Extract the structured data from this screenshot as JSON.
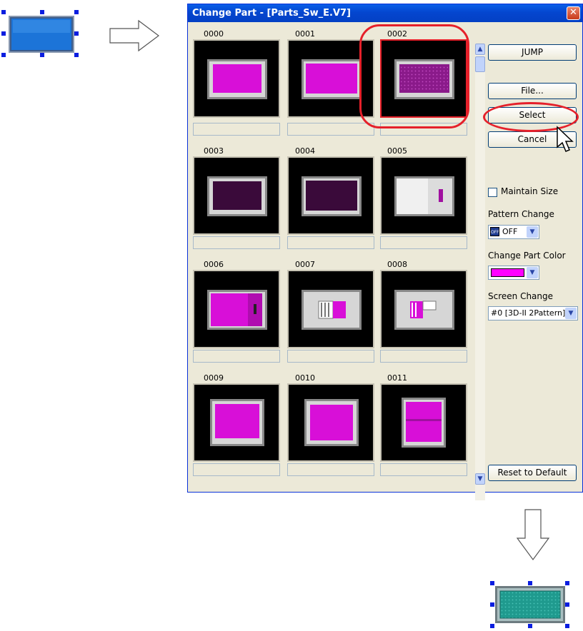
{
  "dialog": {
    "title": "Change Part - [Parts_Sw_E.V7]",
    "close_label": "✕",
    "parts": [
      {
        "id": "0000"
      },
      {
        "id": "0001"
      },
      {
        "id": "0002"
      },
      {
        "id": "0003"
      },
      {
        "id": "0004"
      },
      {
        "id": "0005"
      },
      {
        "id": "0006"
      },
      {
        "id": "0007"
      },
      {
        "id": "0008"
      },
      {
        "id": "0009"
      },
      {
        "id": "0010"
      },
      {
        "id": "0011"
      }
    ],
    "buttons": {
      "jump": "JUMP",
      "file": "File...",
      "select": "Select",
      "cancel": "Cancel",
      "reset": "Reset to Default"
    },
    "options": {
      "maintain_size_label": "Maintain Size",
      "maintain_size_checked": false,
      "pattern_change_label": "Pattern Change",
      "pattern_change_value": "OFF",
      "pattern_badge": "OFF",
      "change_part_color_label": "Change Part Color",
      "change_part_color_value": "#ff00ff",
      "screen_change_label": "Screen Change",
      "screen_change_value": "#0 [3D-II 2Pattern]"
    }
  },
  "colors": {
    "accent": "#e5202a",
    "titlebar": "#0446cf",
    "before_part": "#1c74d8",
    "after_part": "#1f9a8e"
  },
  "icons": {
    "arrow_right": "arrow-right-icon",
    "arrow_down": "arrow-down-icon",
    "cursor": "mouse-pointer-icon"
  }
}
